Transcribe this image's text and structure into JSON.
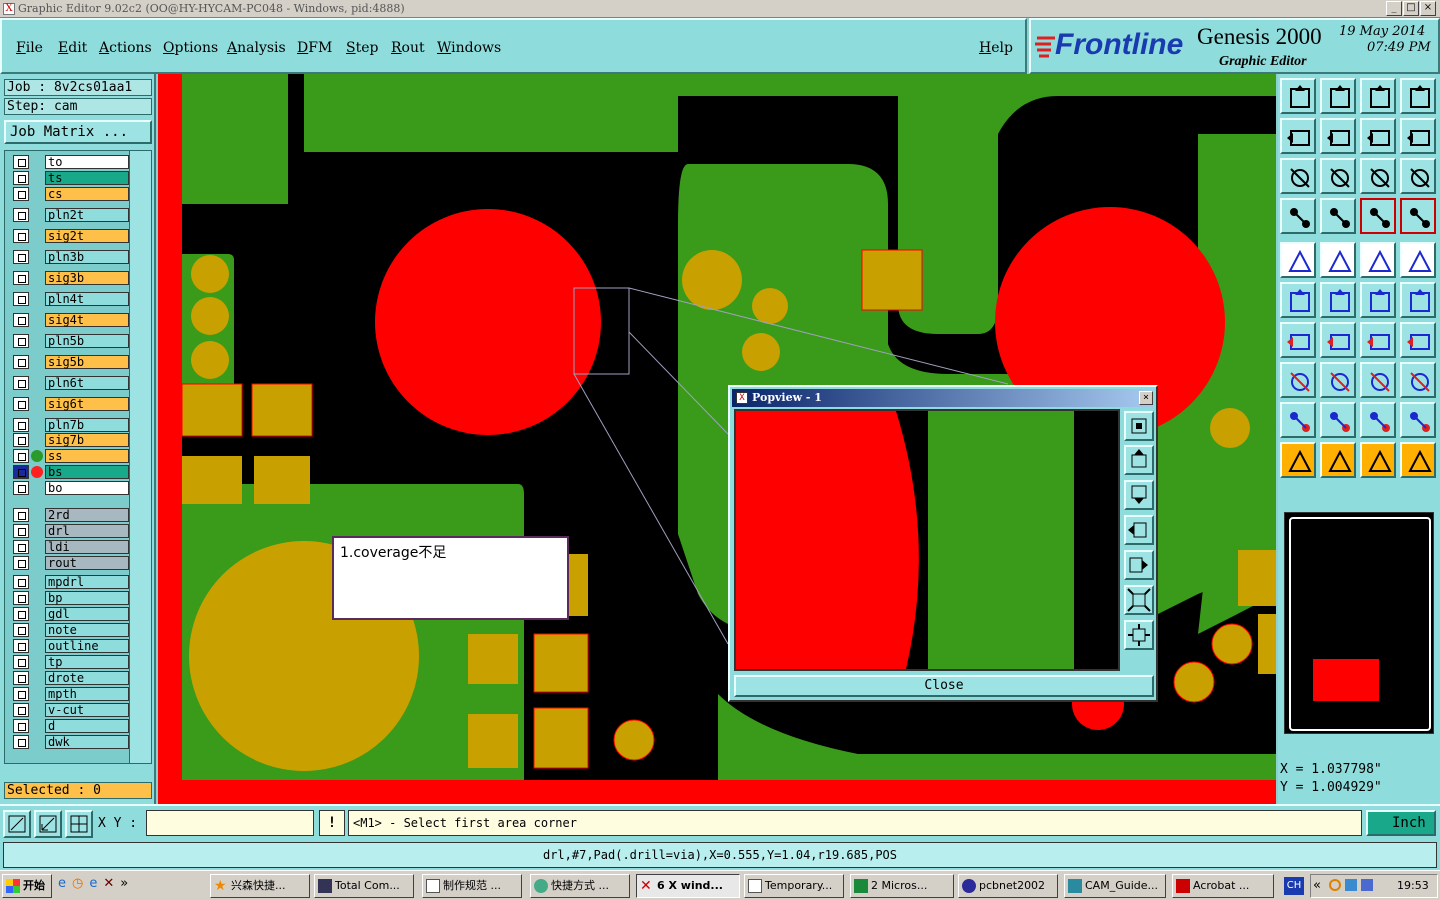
{
  "window": {
    "title": "Graphic Editor 9.02c2  (OO@HY-HYCAM-PC048 - Windows, pid:4888)",
    "min": "_",
    "max": "□",
    "close": "×"
  },
  "menu": {
    "items": [
      "File",
      "Edit",
      "Actions",
      "Options",
      "Analysis",
      "DFM",
      "Step",
      "Rout",
      "Windows"
    ],
    "help": "Help"
  },
  "brand": {
    "logo": "Frontline",
    "product": "Genesis 2000",
    "subtitle": "Graphic Editor",
    "date": "19 May 2014",
    "time": "07:49 PM"
  },
  "job": {
    "job_label": "Job : 8v2cs01aa1",
    "step_label": "Step: cam",
    "matrix_button": "Job Matrix ..."
  },
  "layers": [
    {
      "name": "to",
      "color": "#ffffff"
    },
    {
      "name": "ts",
      "color": "#1aa88a"
    },
    {
      "name": "cs",
      "color": "#ffc04a"
    },
    {
      "name": "pln2t",
      "color": "#8fdcdc"
    },
    {
      "name": "sig2t",
      "color": "#ffc04a"
    },
    {
      "name": "pln3b",
      "color": "#8fdcdc"
    },
    {
      "name": "sig3b",
      "color": "#ffc04a"
    },
    {
      "name": "pln4t",
      "color": "#8fdcdc"
    },
    {
      "name": "sig4t",
      "color": "#ffc04a"
    },
    {
      "name": "pln5b",
      "color": "#8fdcdc"
    },
    {
      "name": "sig5b",
      "color": "#ffc04a"
    },
    {
      "name": "pln6t",
      "color": "#8fdcdc"
    },
    {
      "name": "sig6t",
      "color": "#ffc04a"
    },
    {
      "name": "pln7b",
      "color": "#8fdcdc"
    },
    {
      "name": "sig7b",
      "color": "#ffc04a"
    },
    {
      "name": "ss",
      "color": "#ffc04a",
      "dot": "#2a9a2a"
    },
    {
      "name": "bs",
      "color": "#1aa88a",
      "dot": "#ff2020",
      "active": true
    },
    {
      "name": "bo",
      "color": "#ffffff"
    },
    {
      "name": "2rd",
      "color": "#a8b8c0"
    },
    {
      "name": "drl",
      "color": "#a8b8c0"
    },
    {
      "name": "ldi",
      "color": "#a8b8c0"
    },
    {
      "name": "rout",
      "color": "#a8b8c0"
    },
    {
      "name": "mpdrl",
      "color": "#8fdcdc"
    },
    {
      "name": "bp",
      "color": "#8fdcdc"
    },
    {
      "name": "gdl",
      "color": "#8fdcdc"
    },
    {
      "name": "note",
      "color": "#8fdcdc"
    },
    {
      "name": "outline",
      "color": "#8fdcdc"
    },
    {
      "name": "tp",
      "color": "#8fdcdc"
    },
    {
      "name": "drote",
      "color": "#8fdcdc"
    },
    {
      "name": "mpth",
      "color": "#8fdcdc"
    },
    {
      "name": "v-cut",
      "color": "#8fdcdc"
    },
    {
      "name": "d",
      "color": "#8fdcdc"
    },
    {
      "name": "dwk",
      "color": "#8fdcdc"
    }
  ],
  "selected": "Selected : 0",
  "note_text": "1.coverage不足",
  "popview": {
    "title": "Popview - 1",
    "close_label": "Close"
  },
  "coords": {
    "x": "X  =  1.037798\"",
    "y": "Y  =  1.004929\""
  },
  "command": {
    "xy_label": "X Y :",
    "xy_value": "",
    "prompt": "<M1> - Select first area corner",
    "unit": "Inch"
  },
  "status": "drl,#7,Pad(.drill=via),X=0.555,Y=1.04,r19.685,POS",
  "taskbar": {
    "start": "开始",
    "tasks": [
      "兴森快捷...",
      "Total Com...",
      "制作规范 ...",
      "快捷方式 ...",
      "6 X wind...",
      "Temporary...",
      "2 Micros...",
      "pcbnet2002",
      "CAM_Guide...",
      "Acrobat ..."
    ],
    "lang": "CH",
    "clock": "19:53"
  },
  "colors": {
    "board_red": "#ff0000",
    "copper_green": "#3a9a1a",
    "pad_gold": "#c8a000",
    "panel_cyan": "#8fdcdc"
  }
}
